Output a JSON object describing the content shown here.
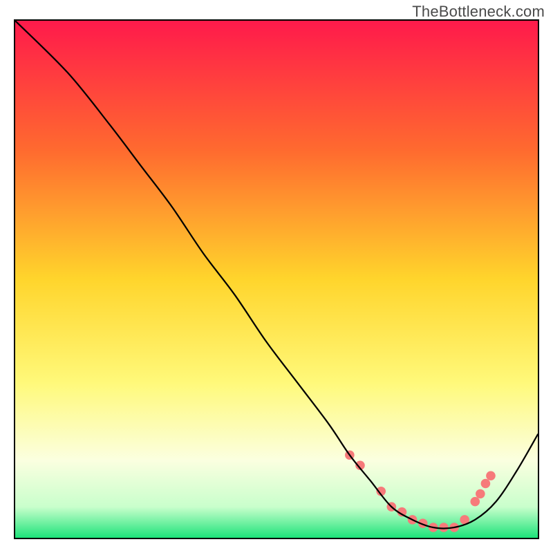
{
  "watermark": "TheBottleneck.com",
  "chart_data": {
    "type": "line",
    "title": "",
    "xlabel": "",
    "ylabel": "",
    "xlim": [
      0,
      100
    ],
    "ylim": [
      0,
      100
    ],
    "grid": false,
    "legend": false,
    "gradient_stops": [
      {
        "offset": 0,
        "color": "#ff1a4b"
      },
      {
        "offset": 25,
        "color": "#ff6a2f"
      },
      {
        "offset": 50,
        "color": "#ffd52c"
      },
      {
        "offset": 70,
        "color": "#fff97a"
      },
      {
        "offset": 85,
        "color": "#fbffe0"
      },
      {
        "offset": 94,
        "color": "#c9ffcc"
      },
      {
        "offset": 100,
        "color": "#1de37a"
      }
    ],
    "series": [
      {
        "name": "bottleneck-curve",
        "color": "#000000",
        "x": [
          0,
          10,
          18,
          24,
          30,
          36,
          42,
          48,
          54,
          60,
          64,
          68,
          72,
          76,
          80,
          84,
          88,
          92,
          96,
          100
        ],
        "y": [
          100,
          90,
          80,
          72,
          64,
          55,
          47,
          38,
          30,
          22,
          16,
          11,
          6,
          3.5,
          2,
          2,
          3.5,
          7,
          13,
          20
        ]
      }
    ],
    "markers": {
      "name": "highlight-range",
      "color": "#f67a7a",
      "radius_pct": 0.9,
      "x": [
        64,
        66,
        70,
        72,
        74,
        76,
        78,
        80,
        82,
        84,
        86,
        88,
        89,
        90,
        91
      ],
      "y": [
        16,
        14,
        9,
        6,
        5,
        3.5,
        2.8,
        2,
        2,
        2,
        3.5,
        7,
        8.5,
        10.5,
        12
      ]
    }
  }
}
